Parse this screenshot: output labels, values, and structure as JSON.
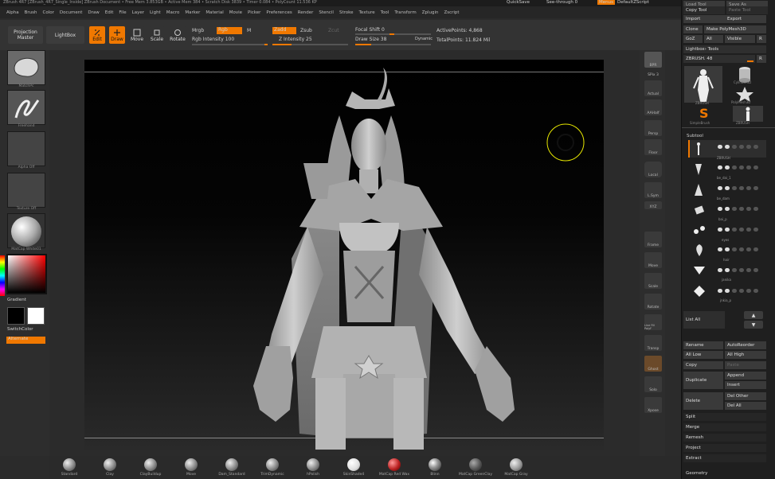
{
  "titlebar": {
    "text": "ZBrush 4R7 [ZBrush_4R7_Single_Inside] ZBrush Document  • Free Mem 3.853GB • Active Mem 384 • Scratch Disk 3839 • Timer 0.084 • PolyCount 11.536 KP",
    "quicksave": "QuickSave",
    "seethrough": "See-through 0",
    "menus_btn": "Menus",
    "defaultscript": "DefaultZScript"
  },
  "menubar": [
    "Alpha",
    "Brush",
    "Color",
    "Document",
    "Draw",
    "Edit",
    "File",
    "Layer",
    "Light",
    "Macro",
    "Marker",
    "Material",
    "Movie",
    "Picker",
    "Preferences",
    "Render",
    "Stencil",
    "Stroke",
    "Texture",
    "Tool",
    "Transform",
    "Zplugin",
    "Zscript"
  ],
  "toolbar": {
    "projection_master": "Projection Master",
    "lightbox": "LightBox",
    "edit": "Edit",
    "draw": "Draw",
    "move": "Move",
    "scale": "Scale",
    "rotate": "Rotate",
    "mrgb": "Mrgb",
    "rgb": "Rgb",
    "m": "M",
    "rgb_intensity": "Rgb Intensity 100",
    "zadd": "Zadd",
    "zsub": "Zsub",
    "zcut": "Zcut",
    "z_intensity": "Z Intensity 25",
    "focal_shift": "Focal Shift 0",
    "draw_size": "Draw Size 38",
    "dynamic": "Dynamic",
    "active_points": "ActivePoints: 4,868",
    "total_points": "TotalPoints: 11.824 Mil"
  },
  "leftshelf": {
    "tiles": [
      "MatchPc",
      "Freehand",
      "Alpha Off",
      "Texture Off",
      "MatCap White01"
    ],
    "gradient": "Gradient",
    "switchcolor": "SwitchColor",
    "alternate": "Alternate",
    "colors": {
      "main": "#000000",
      "secondary": "#ffffff"
    }
  },
  "rightshelf": [
    "BPR",
    "SPix 3",
    "Actual",
    "AAHalf",
    "Persp",
    "Floor",
    "Local",
    "L.Sym",
    "XYZ",
    "Frame",
    "Move",
    "Scale",
    "Rotate",
    "Line Fill PolyF",
    "Transp",
    "Ghost",
    "Solo",
    "Xpose"
  ],
  "panel": {
    "top": [
      "Load Tool",
      "Save As",
      "Copy Tool",
      "Paste Tool",
      "Import",
      "Export",
      "Clone",
      "Make PolyMesh3D",
      "GoZ",
      "All",
      "Visible",
      "R"
    ],
    "lightbox_tools": "Lightbox› Tools",
    "zbrush_slider": "ZBRUSH. 48",
    "r": "R",
    "tools": [
      "ZBRUSH",
      "Cylinder3D",
      "SimpleBrush",
      "PolyMesh3D",
      "ZBRUSH"
    ],
    "subtool_title": "Subtool",
    "subtools": [
      "ZBRUSH",
      "be_dai_1",
      "be_dam",
      "bai_p",
      "eyes",
      "hair",
      "janika",
      "jnkia_p"
    ],
    "list_all": "List All",
    "actions": [
      "Rename",
      "AutoReorder",
      "All Low",
      "All High",
      "Copy",
      "Paste",
      "Duplicate",
      "Append",
      "Insert",
      "Delete",
      "Del Other",
      "Del All",
      "Split",
      "Merge",
      "Remesh",
      "Project",
      "Extract",
      "Geometry"
    ]
  },
  "brushes": [
    "Standard",
    "Clay",
    "ClayBuildup",
    "Move",
    "Dam_Standard",
    "TrimDynamic",
    "hPolish",
    "SkinShade4",
    "MatCap Red Wax",
    "Blinn",
    "MatCap GreenClay",
    "MatCap Gray"
  ],
  "accent": "#f07800"
}
